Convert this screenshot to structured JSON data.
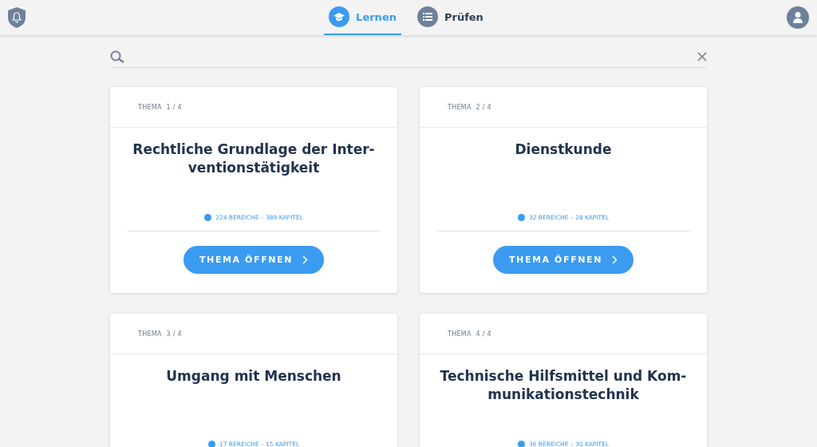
{
  "tabs": [
    {
      "label": "Lernen",
      "kind": "learn",
      "selected": true
    },
    {
      "label": "Prüfen",
      "kind": "test",
      "selected": false
    }
  ],
  "topics": [
    {
      "label": "THEMA  1 / 4",
      "title_lines": [
        "Rechtliche Grundlage der Inter-",
        "ventionstätigkeit"
      ],
      "stats": "224 BEREICHE – 389 KAPITEL",
      "button": "THEMA ÖFFNEN"
    },
    {
      "label": "THEMA  2 / 4",
      "title_lines": [
        "Dienstkunde"
      ],
      "stats": "32 BEREICHE – 28 KAPITEL",
      "button": "THEMA ÖFFNEN"
    },
    {
      "label": "THEMA  3 / 4",
      "title_lines": [
        "Umgang mit Menschen"
      ],
      "stats": "17 BEREICHE – 15 KAPITEL"
    },
    {
      "label": "THEMA  4 / 4",
      "title_lines": [
        "Technische Hilfsmittel und Kom-",
        "munikationstechnik"
      ],
      "stats": "36 BEREICHE – 30 KAPITEL"
    }
  ]
}
